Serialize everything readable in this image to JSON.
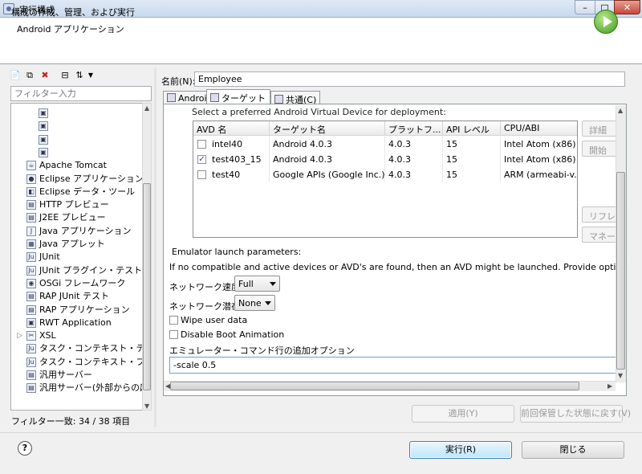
{
  "window": {
    "title": "実行構成",
    "minimize": "–",
    "maximize": "□",
    "close": "✕"
  },
  "header": {
    "title": "構成の作成、管理、および実行",
    "subtitle": "Android アプリケーション"
  },
  "left": {
    "filter_placeholder": "フィルター入力",
    "tree_items": [
      {
        "label": "",
        "icon": "config"
      },
      {
        "label": "",
        "icon": "config"
      },
      {
        "label": "",
        "icon": "config"
      },
      {
        "label": "",
        "icon": "config"
      },
      {
        "label": "Apache Tomcat",
        "icon": "tomcat"
      },
      {
        "label": "Eclipse アプリケーション",
        "icon": "eclipse"
      },
      {
        "label": "Eclipse データ・ツール",
        "icon": "data"
      },
      {
        "label": "HTTP プレビュー",
        "icon": "http"
      },
      {
        "label": "J2EE プレビュー",
        "icon": "j2ee"
      },
      {
        "label": "Java アプリケーション",
        "icon": "java"
      },
      {
        "label": "Java アプレット",
        "icon": "applet"
      },
      {
        "label": "JUnit",
        "icon": "junit"
      },
      {
        "label": "JUnit プラグイン・テスト",
        "icon": "junit"
      },
      {
        "label": "OSGi フレームワーク",
        "icon": "osgi"
      },
      {
        "label": "RAP JUnit テスト",
        "icon": "rap"
      },
      {
        "label": "RAP アプリケーション",
        "icon": "rap"
      },
      {
        "label": "RWT Application",
        "icon": "rwt"
      },
      {
        "label": "XSL",
        "icon": "xsl",
        "expandable": true
      },
      {
        "label": "タスク・コンテキスト・テスト",
        "icon": "task"
      },
      {
        "label": "タスク・コンテキスト・プラグ",
        "icon": "task"
      },
      {
        "label": "汎用サーバー",
        "icon": "server"
      },
      {
        "label": "汎用サーバー(外部からの起動)",
        "icon": "server"
      }
    ],
    "filter_count": "フィルター一致: 34 / 38 項目"
  },
  "right": {
    "name_label": "名前(N):",
    "name_value": "Employee",
    "tabs": [
      {
        "label": "Android",
        "active": false
      },
      {
        "label": "ターゲット",
        "active": true
      },
      {
        "label": "共通(C)",
        "active": false
      }
    ],
    "avd_prompt": "Select a preferred Android Virtual Device for deployment:",
    "avd_columns": [
      "AVD 名",
      "ターゲット名",
      "プラットフ...",
      "API レベル",
      "CPU/ABI"
    ],
    "avd_rows": [
      {
        "checked": false,
        "name": "intel40",
        "target": "Android 4.0.3",
        "platform": "4.0.3",
        "api": "15",
        "cpu": "Intel Atom (x86)"
      },
      {
        "checked": true,
        "name": "test403_15",
        "target": "Android 4.0.3",
        "platform": "4.0.3",
        "api": "15",
        "cpu": "Intel Atom (x86)"
      },
      {
        "checked": false,
        "name": "test40",
        "target": "Google APIs (Google Inc.)",
        "platform": "4.0.3",
        "api": "15",
        "cpu": "ARM (armeabi-v..."
      }
    ],
    "avd_buttons": {
      "details": "詳細",
      "start": "開始",
      "refresh": "リフレッ",
      "manager": "マネージ"
    },
    "emulator": {
      "title": "Emulator launch parameters:",
      "hint": "If no compatible and active devices or AVD's are found, then an AVD might be launched. Provide options for the AVD launch",
      "network_speed_label": "ネットワーク速度:",
      "network_speed_value": "Full",
      "network_latency_label": "ネットワーク潜在:",
      "network_latency_value": "None",
      "wipe_user_data": "Wipe user data",
      "disable_boot_animation": "Disable Boot Animation",
      "options_label": "エミュレーター・コマンド行の追加オプション",
      "options_value": "-scale 0.5"
    },
    "apply": "適用(Y)",
    "revert": "前回保管した状態に戻す(V)"
  },
  "footer": {
    "help": "?",
    "run": "実行(R)",
    "close": "閉じる"
  }
}
